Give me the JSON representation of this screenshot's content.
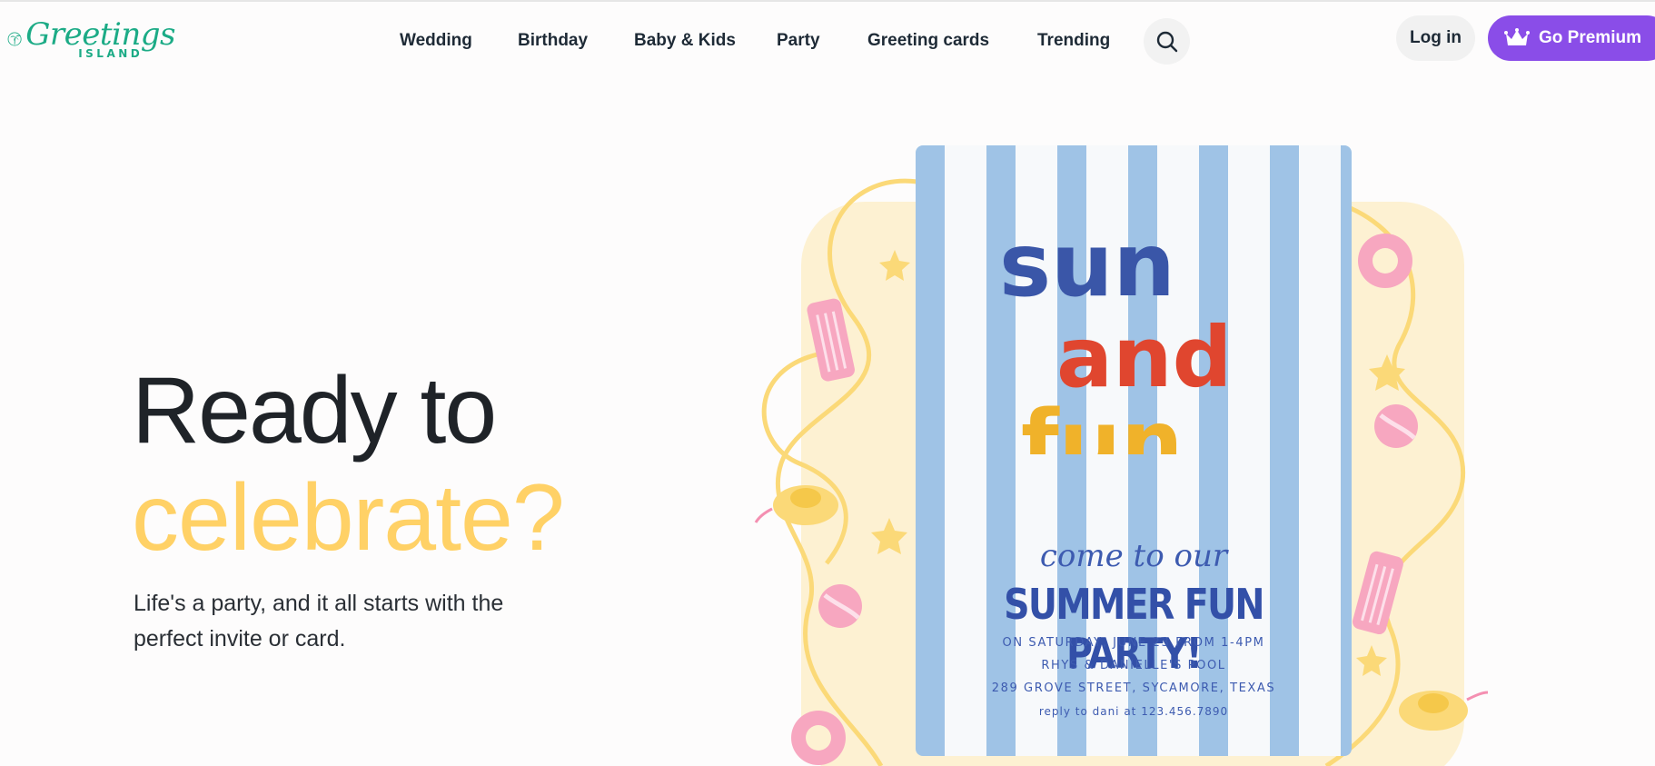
{
  "logo": {
    "script": "Greetings",
    "sub": "ISLAND",
    "icon": "palm-tree-icon"
  },
  "nav": {
    "items": [
      "Wedding",
      "Birthday",
      "Baby & Kids",
      "Party",
      "Greeting cards",
      "Trending"
    ],
    "search_icon": "search-icon"
  },
  "header": {
    "login_label": "Log in",
    "premium_label": "Go Premium",
    "premium_icon": "crown-icon"
  },
  "hero": {
    "line1": "Ready to",
    "line2": "celebrate?",
    "subtitle": "Life's a party, and it all starts with the perfect invite or card."
  },
  "invite_card": {
    "headline": [
      "sun",
      "and",
      "fun"
    ],
    "come": "come to our",
    "title": "SUMMER FUN PARTY!",
    "date_line": "ON SATURDAY, JUNE 23 FROM 1-4PM",
    "place_line": "RHYS & DANIELLE'S POOL",
    "address_line": "289 GROVE STREET, SYCAMORE, TEXAS",
    "reply_line": "reply to dani at 123.456.7890"
  },
  "colors": {
    "brand_green": "#1cab86",
    "premium_purple": "#8a4de8",
    "hero_yellow": "#ffd166",
    "card_stripe": "#9fc3e6",
    "card_text": "#3350a8"
  }
}
